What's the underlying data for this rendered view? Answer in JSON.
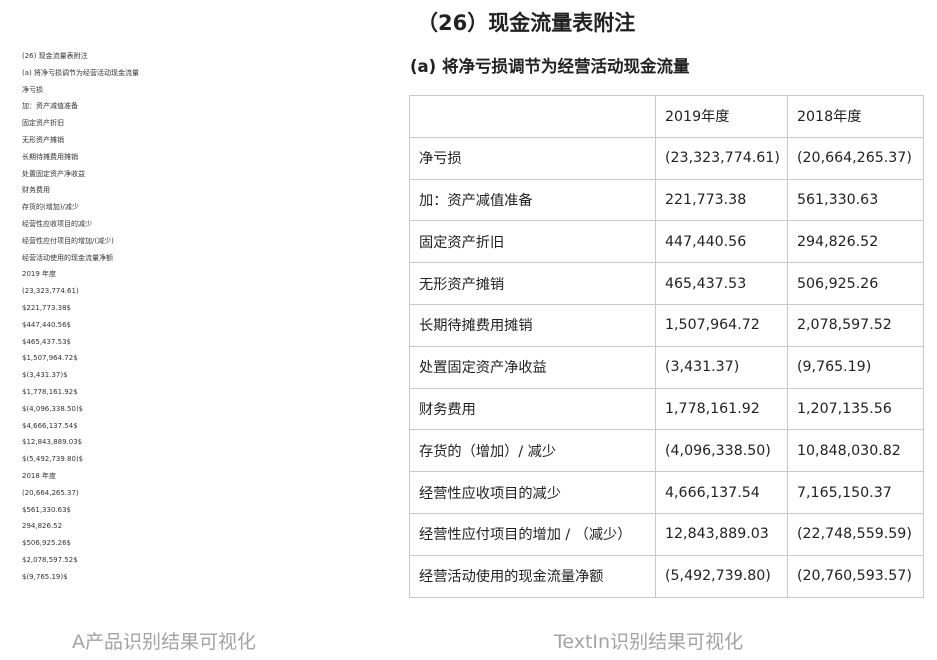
{
  "left_panel": {
    "lines": [
      "(26) 现金流量表附注",
      "(a) 将净亏损调节为经营活动现金流量",
      "净亏损",
      "加：资产减值准备",
      "固定资产折旧",
      "无形资产摊销",
      "长期待摊费用摊销",
      "处置固定资产净收益",
      "财务费用",
      "存货的(增加)/减少",
      "经营性应收项目的减少",
      "经营性应付项目的增加/(减少)",
      "经营活动使用的现金流量净额",
      "2019 年度",
      "(23,323,774.61)",
      "$221,773.38$",
      "$447,440.56$",
      "$465,437.53$",
      "$1,507,964.72$",
      "$(3,431.37)$",
      "$1,778,161.92$",
      "$(4,096,338.50)$",
      "$4,666,137.54$",
      "$12,843,889.03$",
      "$(5,492,739.80)$",
      "2018 年度",
      "(20,664,265.37)",
      "$561,330.63$",
      "294,826.52",
      "$506,925.26$",
      "$2,078,597.52$",
      "$(9,765.19)$"
    ]
  },
  "right_panel": {
    "title": "（26）现金流量表附注",
    "subtitle": "(a) 将净亏损调节为经营活动现金流量",
    "table": {
      "header": [
        "",
        "2019年度",
        "2018年度"
      ],
      "rows": [
        [
          "净亏损",
          "(23,323,774.61)",
          "(20,664,265.37)"
        ],
        [
          "加：资产减值准备",
          "221,773.38",
          "561,330.63"
        ],
        [
          "固定资产折旧",
          "447,440.56",
          "294,826.52"
        ],
        [
          "无形资产摊销",
          "465,437.53",
          "506,925.26"
        ],
        [
          "长期待摊费用摊销",
          "1,507,964.72",
          "2,078,597.52"
        ],
        [
          "处置固定资产净收益",
          "(3,431.37)",
          "(9,765.19)"
        ],
        [
          "财务费用",
          "1,778,161.92",
          "1,207,135.56"
        ],
        [
          "存货的（增加）/ 减少",
          "(4,096,338.50)",
          "10,848,030.82"
        ],
        [
          "经营性应收项目的减少",
          "4,666,137.54",
          "7,165,150.37"
        ],
        [
          "经营性应付项目的增加 / （减少）",
          "12,843,889.03",
          "(22,748,559.59)"
        ],
        [
          "经营活动使用的现金流量净额",
          "(5,492,739.80)",
          "(20,760,593.57)"
        ]
      ]
    }
  },
  "captions": {
    "left": "A产品识别结果可视化",
    "right": "TextIn识别结果可视化"
  }
}
